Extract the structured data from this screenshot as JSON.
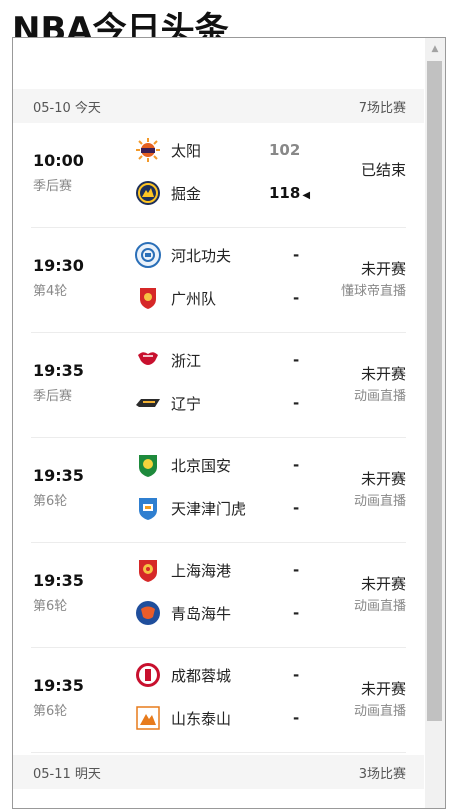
{
  "page_title": "NBA今日头条",
  "days": [
    {
      "date_label": "05-10 今天",
      "count_label": "7场比赛"
    },
    {
      "date_label": "05-11 明天",
      "count_label": "3场比赛"
    }
  ],
  "matches": [
    {
      "time": "10:00",
      "round": "季后赛",
      "home": "太阳",
      "away": "掘金",
      "home_score": "102",
      "away_score": "118",
      "status": "已结束",
      "broadcast": ""
    },
    {
      "time": "19:30",
      "round": "第4轮",
      "home": "河北功夫",
      "away": "广州队",
      "home_score": "-",
      "away_score": "-",
      "status": "未开赛",
      "broadcast": "懂球帝直播"
    },
    {
      "time": "19:35",
      "round": "季后赛",
      "home": "浙江",
      "away": "辽宁",
      "home_score": "-",
      "away_score": "-",
      "status": "未开赛",
      "broadcast": "动画直播"
    },
    {
      "time": "19:35",
      "round": "第6轮",
      "home": "北京国安",
      "away": "天津津门虎",
      "home_score": "-",
      "away_score": "-",
      "status": "未开赛",
      "broadcast": "动画直播"
    },
    {
      "time": "19:35",
      "round": "第6轮",
      "home": "上海海港",
      "away": "青岛海牛",
      "home_score": "-",
      "away_score": "-",
      "status": "未开赛",
      "broadcast": "动画直播"
    },
    {
      "time": "19:35",
      "round": "第6轮",
      "home": "成都蓉城",
      "away": "山东泰山",
      "home_score": "-",
      "away_score": "-",
      "status": "未开赛",
      "broadcast": "动画直播"
    }
  ],
  "icons": {
    "home": [
      "suns-logo-icon",
      "hebei-logo-icon",
      "zhejiang-logo-icon",
      "guoan-logo-icon",
      "haigang-logo-icon",
      "rongcheng-logo-icon"
    ],
    "away": [
      "nuggets-logo-icon",
      "guangzhou-logo-icon",
      "liaoning-logo-icon",
      "jinmenhu-logo-icon",
      "hainiu-logo-icon",
      "taishan-logo-icon"
    ]
  },
  "colors": {
    "accent_suns": "#e56020",
    "accent_nuggets": "#1d2f5a",
    "accent_guoan": "#1e8a3c",
    "accent_red": "#d62828"
  }
}
